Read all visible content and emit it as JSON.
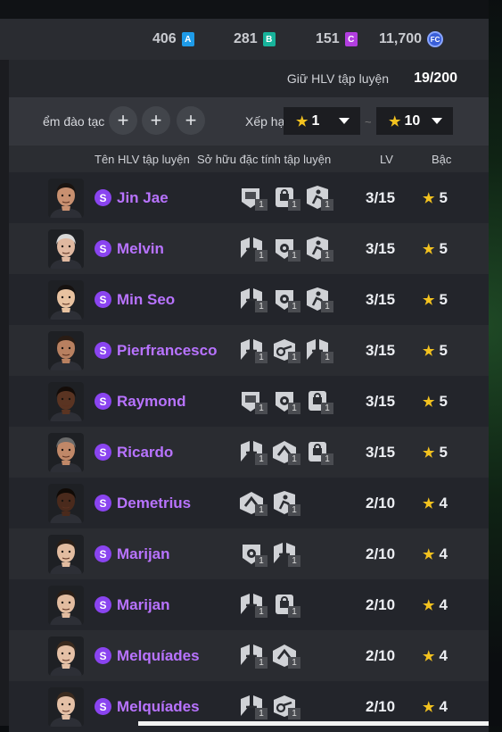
{
  "currencies": [
    {
      "value": "406",
      "badge": "A",
      "color": "#1e9be8"
    },
    {
      "value": "281",
      "badge": "B",
      "color": "#17b39b"
    },
    {
      "value": "151",
      "badge": "C",
      "color": "#b23ee0"
    }
  ],
  "fc_points": "11,700",
  "fc_icon_label": "FC",
  "hold": {
    "label": "Giữ HLV tập luyện",
    "value": "19/200"
  },
  "filter": {
    "label": "ểm đào tạc",
    "plus": "+",
    "sort_label": "Xếp hạ",
    "star": "★",
    "from": "1",
    "to": "10",
    "tilde": "~"
  },
  "columns": {
    "name": "Tên HLV tập luyện",
    "traits": "Sở hữu đặc tính tập luyện",
    "lv": "LV",
    "grade": "Bậc"
  },
  "badge_letter": "S",
  "trait_count": "1",
  "coaches": [
    {
      "name": "Jin Jae",
      "lv": "3/15",
      "grade": "5",
      "traits": [
        "shield",
        "lock",
        "runner"
      ],
      "skin": "#c89070",
      "hair": "#1a1410"
    },
    {
      "name": "Melvin",
      "lv": "3/15",
      "grade": "5",
      "traits": [
        "swap",
        "ball",
        "runner"
      ],
      "skin": "#e0b8a0",
      "hair": "#d8d8d8"
    },
    {
      "name": "Min Seo",
      "lv": "3/15",
      "grade": "5",
      "traits": [
        "swap",
        "ball",
        "runner"
      ],
      "skin": "#e8c2a0",
      "hair": "#161210"
    },
    {
      "name": "Pierfrancesco",
      "lv": "3/15",
      "grade": "5",
      "traits": [
        "swap",
        "whistle",
        "swap"
      ],
      "skin": "#b88060",
      "hair": "#2a1c14"
    },
    {
      "name": "Raymond",
      "lv": "3/15",
      "grade": "5",
      "traits": [
        "shield",
        "ball",
        "lock"
      ],
      "skin": "#5a3422",
      "hair": "#140c08"
    },
    {
      "name": "Ricardo",
      "lv": "3/15",
      "grade": "5",
      "traits": [
        "swap",
        "arrow",
        "lock"
      ],
      "skin": "#c08868",
      "hair": "#6a6a6a"
    },
    {
      "name": "Demetrius",
      "lv": "2/10",
      "grade": "4",
      "traits": [
        "arrow",
        "runner"
      ],
      "skin": "#4a2a1c",
      "hair": "#100a06"
    },
    {
      "name": "Marijan",
      "lv": "2/10",
      "grade": "4",
      "traits": [
        "ball",
        "swap"
      ],
      "skin": "#e2bca0",
      "hair": "#2a1e16"
    },
    {
      "name": "Marijan",
      "lv": "2/10",
      "grade": "4",
      "traits": [
        "swap",
        "lock"
      ],
      "skin": "#e2bca0",
      "hair": "#2a1e16"
    },
    {
      "name": "Melquíades",
      "lv": "2/10",
      "grade": "4",
      "traits": [
        "swap",
        "arrow"
      ],
      "skin": "#e4c0a6",
      "hair": "#3a2a1e"
    },
    {
      "name": "Melquíades",
      "lv": "2/10",
      "grade": "4",
      "traits": [
        "swap",
        "whistle"
      ],
      "skin": "#e4c0a6",
      "hair": "#3a2a1e"
    }
  ]
}
